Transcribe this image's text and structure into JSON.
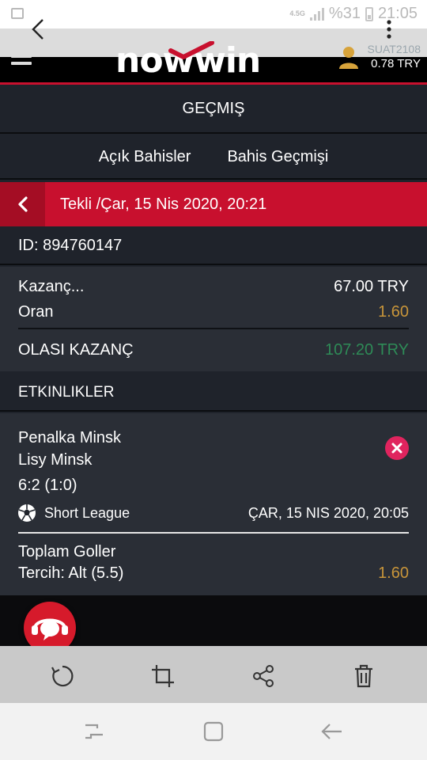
{
  "status_bar": {
    "network": "4.5G",
    "battery_text": "%31",
    "time": "21:05"
  },
  "header": {
    "logo_text": "nowwin",
    "username": "SUAT2108",
    "balance": "0.78 TRY"
  },
  "page": {
    "title": "GEÇMIŞ"
  },
  "tabs": [
    {
      "label": "Açık Bahisler"
    },
    {
      "label": "Bahis Geçmişi"
    }
  ],
  "bet": {
    "heading": "Tekli /Çar, 15 Nis 2020, 20:21",
    "id_text": "ID: 894760147",
    "stake_label": "Kazanç...",
    "stake_value": "67.00 TRY",
    "odds_label": "Oran",
    "odds_value": "1.60",
    "potential_label": "OLASI KAZANÇ",
    "potential_value": "107.20 TRY"
  },
  "events": {
    "heading": "ETKINLIKLER",
    "items": [
      {
        "home": "Penalka Minsk",
        "away": "Lisy Minsk",
        "score": "6:2 (1:0)",
        "league": "Short League",
        "datetime": "ÇAR, 15 NIS 2020, 20:05",
        "market": "Toplam Goller",
        "selection": "Tercih: Alt (5.5)",
        "odds": "1.60"
      }
    ]
  },
  "colors": {
    "brand_red": "#c8102e",
    "odds_gold": "#c8953a",
    "win_green": "#2e8b57",
    "close_pink": "#e0245e"
  },
  "icons": {
    "status": [
      "image-icon",
      "signal-icon",
      "battery-icon"
    ],
    "viewer": [
      "back-arrow-icon",
      "more-vert-icon"
    ],
    "toolbar": [
      "rotate-icon",
      "crop-icon",
      "share-icon",
      "trash-icon"
    ],
    "navbar": [
      "recents-icon",
      "home-icon",
      "back-icon"
    ]
  }
}
